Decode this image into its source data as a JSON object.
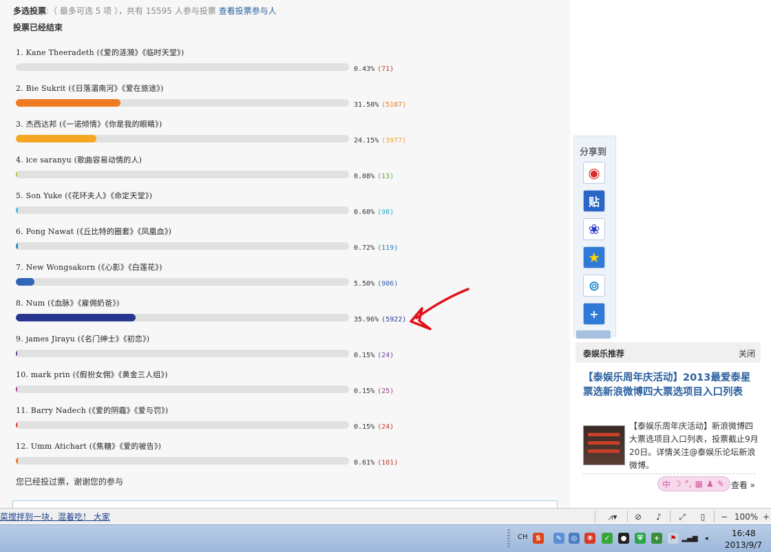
{
  "poll": {
    "type_label": "多选投票",
    "info": ":（ 最多可选 5 项 ），共有 15595 人参与投票",
    "voters_link": "查看投票参与人",
    "ended": "投票已经结束",
    "voted_msg": "您已经投过票，谢谢您的参与",
    "options": [
      {
        "label": "1.  Kane Theeradeth (《爱的涟漪》《临时天堂》)",
        "percent": 0.43,
        "percent_text": "0.43%",
        "count_text": "(71)",
        "color": "#e0e0e0",
        "count_color": "#c0392b"
      },
      {
        "label": "2.  Bie Sukrit (《日落湄南河》《爱在旅途》)",
        "percent": 31.5,
        "percent_text": "31.50%",
        "count_text": "(5187)",
        "color": "#f07a22",
        "count_color": "#e67e22"
      },
      {
        "label": "3.  杰西达邦 (《一诺倾情》《你是我的眼睛》)",
        "percent": 24.15,
        "percent_text": "24.15%",
        "count_text": "(3977)",
        "color": "#f5a623",
        "count_color": "#e6a23c"
      },
      {
        "label": "4.  ice saranyu (歌曲容易动情的人)",
        "percent": 0.08,
        "percent_text": "0.08%",
        "count_text": "(13)",
        "color": "#9ccc3a",
        "count_color": "#5fa52a"
      },
      {
        "label": "5.  Son Yuke (《花环夫人》《命定天堂》)",
        "percent": 0.6,
        "percent_text": "0.60%",
        "count_text": "(98)",
        "color": "#3fbde6",
        "count_color": "#2aa6d1"
      },
      {
        "label": "6.  Pong Nawat (《丘比特的圈套》《凤凰血》)",
        "percent": 0.72,
        "percent_text": "0.72%",
        "count_text": "(119)",
        "color": "#1e8fc9",
        "count_color": "#1e7fbf"
      },
      {
        "label": "7.  New Wongsakorn  (《心影》《白莲花》)",
        "percent": 5.5,
        "percent_text": "5.50%",
        "count_text": "(906)",
        "color": "#2f66b8",
        "count_color": "#2f5fa8"
      },
      {
        "label": "8.  Num  (《血脉》《雇佣奶爸》)",
        "percent": 35.96,
        "percent_text": "35.96%",
        "count_text": "(5922)",
        "color": "#27378f",
        "count_color": "#27378f"
      },
      {
        "label": "9.  james Jirayu (《名门绅士》《初恋》)",
        "percent": 0.15,
        "percent_text": "0.15%",
        "count_text": "(24)",
        "color": "#6a3a9b",
        "count_color": "#6a3a9b"
      },
      {
        "label": "10.  mark prin (《假扮女佣》《黄金三人组》)",
        "percent": 0.15,
        "percent_text": "0.15%",
        "count_text": "(25)",
        "color": "#9b3a8f",
        "count_color": "#9b3a8f"
      },
      {
        "label": "11.  Barry Nadech (《爱的阴霾》《爱与罚》)",
        "percent": 0.15,
        "percent_text": "0.15%",
        "count_text": "(24)",
        "color": "#c0392b",
        "count_color": "#c0392b"
      },
      {
        "label": "12.  Umm Atichart (《焦糖》《爱的被告》)",
        "percent": 0.61,
        "percent_text": "0.61%",
        "count_text": "(101)",
        "color": "#f07a22",
        "count_color": "#c0392b"
      }
    ]
  },
  "share": {
    "title": "分享到",
    "icons": [
      {
        "name": "weibo-icon",
        "glyph": "",
        "bg": "#ffffff",
        "fg": "#d52b2b"
      },
      {
        "name": "tieba-icon",
        "glyph": "贴",
        "bg": "#2a66c7",
        "fg": "#ffffff"
      },
      {
        "name": "baidu-paw-icon",
        "glyph": "",
        "bg": "#ffffff",
        "fg": "#2a39c7"
      },
      {
        "name": "qzone-star-icon",
        "glyph": "",
        "bg": "#2f7ad6",
        "fg": "#ffd400"
      },
      {
        "name": "tencent-weibo-icon",
        "glyph": "",
        "bg": "#ffffff",
        "fg": "#1d8ad6"
      },
      {
        "name": "more-plus-icon",
        "glyph": "+",
        "bg": "#2f7ad6",
        "fg": "#ffffff"
      }
    ]
  },
  "recommend": {
    "title": "泰娱乐推荐",
    "close": "关闭",
    "headline": "【泰娱乐周年庆活动】2013最爱泰星票选新浪微博四大票选项目入口列表",
    "desc": "【泰娱乐周年庆活动】新浪微博四大票选项目入口列表，投票截止9月20日。详情关注@泰娱乐论坛新浪微博。",
    "more": "查看 »"
  },
  "ime": {
    "label": "中"
  },
  "status_bar": {
    "link_text": "菜搅拌到一块，混着吃！ 大家",
    "zoom": "100%"
  },
  "taskbar": {
    "lang": "CH",
    "time": "16:48",
    "date": "2013/9/7"
  }
}
